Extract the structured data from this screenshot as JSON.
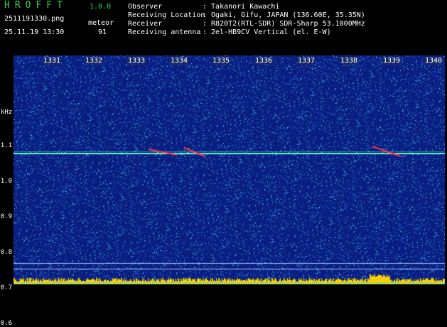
{
  "app": {
    "name": "HROFFT",
    "version": "1.0.0"
  },
  "capture": {
    "filename": "2511191330.png",
    "datetime": "25.11.19 13:30"
  },
  "meteor": {
    "label": "meteor",
    "count": "91"
  },
  "info": [
    {
      "label": "Observer",
      "value": ": Takanori Kawachi"
    },
    {
      "label": "Receiving Location",
      "value": ": Ogaki, Gifu, JAPAN (136.60E, 35.35N)"
    },
    {
      "label": "Receiver",
      "value": ": R820T2(RTL-SDR) SDR-Sharp 53.1000MHz"
    },
    {
      "label": "Receiving antenna",
      "value": ": 2el-HB9CV Vertical (el. E-W)"
    }
  ],
  "axis": {
    "y_unit": "kHz",
    "y_ticks": [
      "1.1",
      "1.0",
      "0.9",
      "0.8",
      "0.7",
      "0.6"
    ],
    "x_ticks": [
      "1331",
      "1332",
      "1333",
      "1334",
      "1335",
      "1336",
      "1337",
      "1338",
      "1339",
      "1340"
    ]
  },
  "colors": {
    "accent": "#39d353",
    "background": "#0b1a5c",
    "carrier": "#5fffc0",
    "echo": "#ff3050",
    "baseline": "#ffd000"
  }
}
